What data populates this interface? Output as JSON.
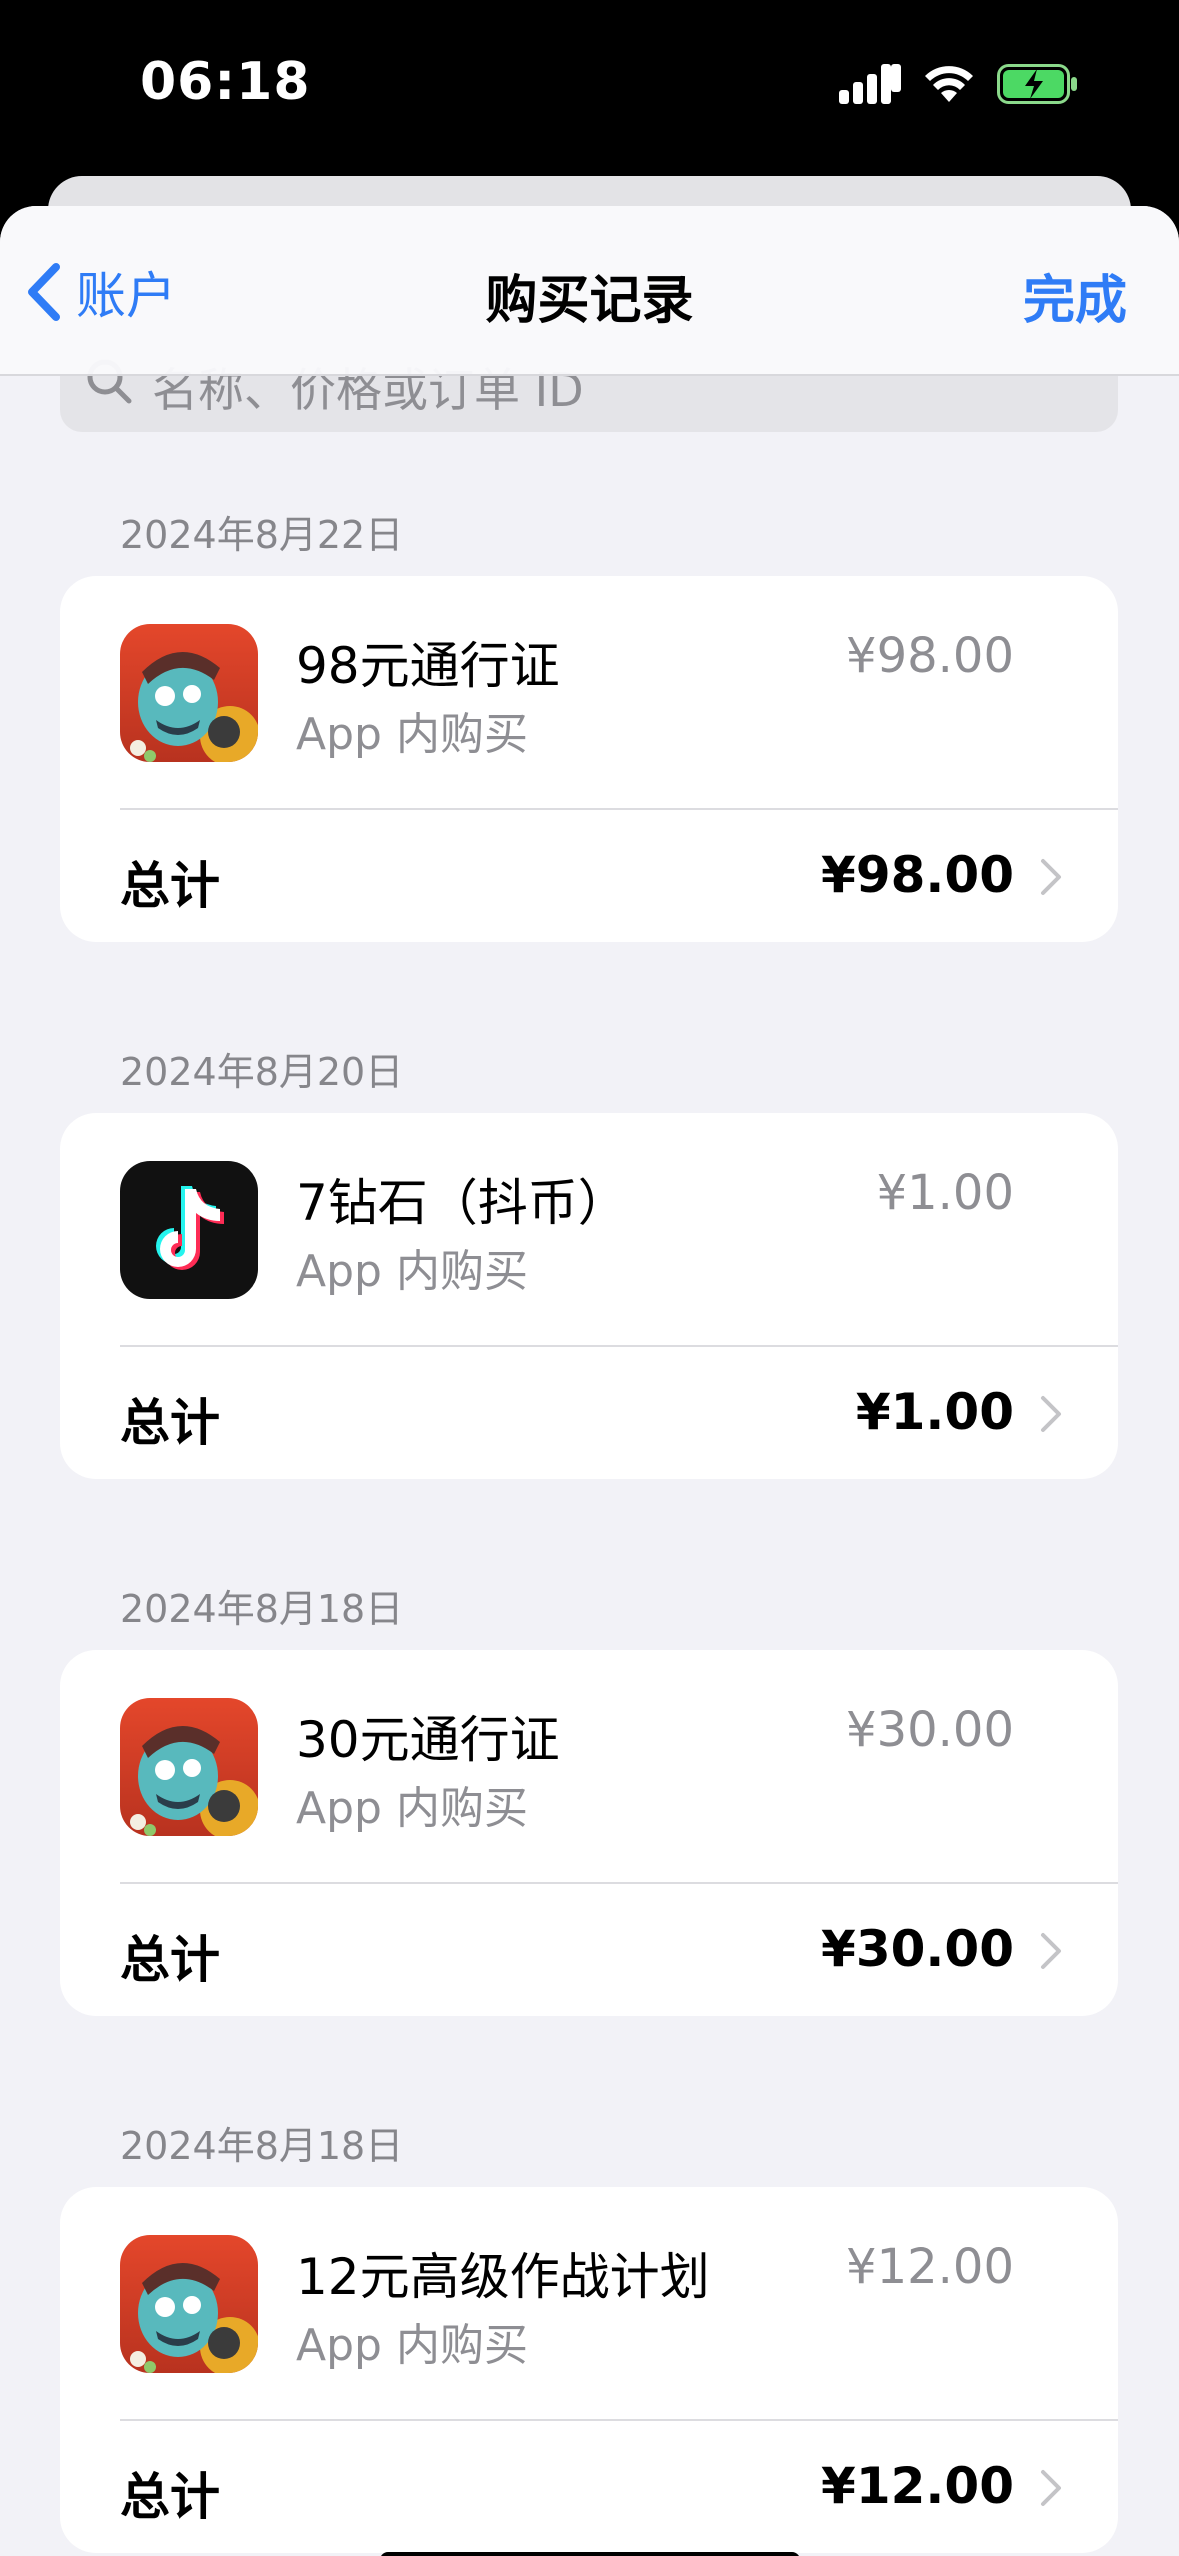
{
  "status_bar": {
    "time": "06:18",
    "icons": [
      "cellular-signal-icon",
      "wifi-icon",
      "battery-charging-icon"
    ]
  },
  "nav": {
    "back_label": "账户",
    "title": "购买记录",
    "done_label": "完成"
  },
  "search": {
    "placeholder": "名称、价格或订单 ID"
  },
  "purchases": [
    {
      "date": "2024年8月22日",
      "item_name": "98元通行证",
      "item_type": "App 内购买",
      "item_price": "¥98.00",
      "total_label": "总计",
      "total_value": "¥98.00",
      "icon": "game-app-icon"
    },
    {
      "date": "2024年8月20日",
      "item_name": "7钻石（抖币）",
      "item_type": "App 内购买",
      "item_price": "¥1.00",
      "total_label": "总计",
      "total_value": "¥1.00",
      "icon": "tiktok-app-icon"
    },
    {
      "date": "2024年8月18日",
      "item_name": "30元通行证",
      "item_type": "App 内购买",
      "item_price": "¥30.00",
      "total_label": "总计",
      "total_value": "¥30.00",
      "icon": "game-app-icon"
    },
    {
      "date": "2024年8月18日",
      "item_name": "12元高级作战计划",
      "item_type": "App 内购买",
      "item_price": "¥12.00",
      "total_label": "总计",
      "total_value": "¥12.00",
      "icon": "game-app-icon"
    }
  ],
  "colors": {
    "accent": "#2f7cf6",
    "background": "#f2f2f7",
    "secondary_text": "#8e8e93"
  }
}
